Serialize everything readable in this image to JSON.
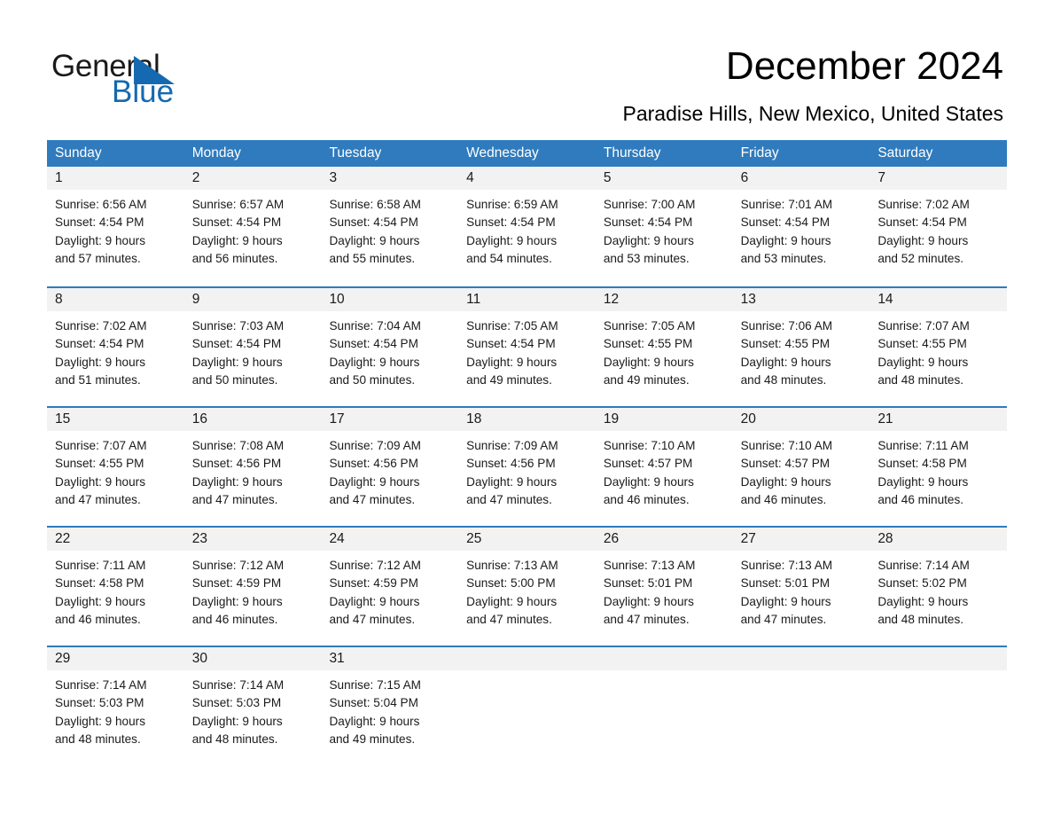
{
  "brand": {
    "name_part1": "General",
    "name_part2": "Blue",
    "accent_color": "#1569b0",
    "triangle_color": "#1569b0"
  },
  "header": {
    "title": "December 2024",
    "location": "Paradise Hills, New Mexico, United States"
  },
  "calendar": {
    "header_bg": "#2f7bbd",
    "day_band_bg": "#f2f2f2",
    "weekday_labels": [
      "Sunday",
      "Monday",
      "Tuesday",
      "Wednesday",
      "Thursday",
      "Friday",
      "Saturday"
    ],
    "weeks": [
      [
        {
          "day": "1",
          "sunrise": "Sunrise: 6:56 AM",
          "sunset": "Sunset: 4:54 PM",
          "daylight_line1": "Daylight: 9 hours",
          "daylight_line2": "and 57 minutes."
        },
        {
          "day": "2",
          "sunrise": "Sunrise: 6:57 AM",
          "sunset": "Sunset: 4:54 PM",
          "daylight_line1": "Daylight: 9 hours",
          "daylight_line2": "and 56 minutes."
        },
        {
          "day": "3",
          "sunrise": "Sunrise: 6:58 AM",
          "sunset": "Sunset: 4:54 PM",
          "daylight_line1": "Daylight: 9 hours",
          "daylight_line2": "and 55 minutes."
        },
        {
          "day": "4",
          "sunrise": "Sunrise: 6:59 AM",
          "sunset": "Sunset: 4:54 PM",
          "daylight_line1": "Daylight: 9 hours",
          "daylight_line2": "and 54 minutes."
        },
        {
          "day": "5",
          "sunrise": "Sunrise: 7:00 AM",
          "sunset": "Sunset: 4:54 PM",
          "daylight_line1": "Daylight: 9 hours",
          "daylight_line2": "and 53 minutes."
        },
        {
          "day": "6",
          "sunrise": "Sunrise: 7:01 AM",
          "sunset": "Sunset: 4:54 PM",
          "daylight_line1": "Daylight: 9 hours",
          "daylight_line2": "and 53 minutes."
        },
        {
          "day": "7",
          "sunrise": "Sunrise: 7:02 AM",
          "sunset": "Sunset: 4:54 PM",
          "daylight_line1": "Daylight: 9 hours",
          "daylight_line2": "and 52 minutes."
        }
      ],
      [
        {
          "day": "8",
          "sunrise": "Sunrise: 7:02 AM",
          "sunset": "Sunset: 4:54 PM",
          "daylight_line1": "Daylight: 9 hours",
          "daylight_line2": "and 51 minutes."
        },
        {
          "day": "9",
          "sunrise": "Sunrise: 7:03 AM",
          "sunset": "Sunset: 4:54 PM",
          "daylight_line1": "Daylight: 9 hours",
          "daylight_line2": "and 50 minutes."
        },
        {
          "day": "10",
          "sunrise": "Sunrise: 7:04 AM",
          "sunset": "Sunset: 4:54 PM",
          "daylight_line1": "Daylight: 9 hours",
          "daylight_line2": "and 50 minutes."
        },
        {
          "day": "11",
          "sunrise": "Sunrise: 7:05 AM",
          "sunset": "Sunset: 4:54 PM",
          "daylight_line1": "Daylight: 9 hours",
          "daylight_line2": "and 49 minutes."
        },
        {
          "day": "12",
          "sunrise": "Sunrise: 7:05 AM",
          "sunset": "Sunset: 4:55 PM",
          "daylight_line1": "Daylight: 9 hours",
          "daylight_line2": "and 49 minutes."
        },
        {
          "day": "13",
          "sunrise": "Sunrise: 7:06 AM",
          "sunset": "Sunset: 4:55 PM",
          "daylight_line1": "Daylight: 9 hours",
          "daylight_line2": "and 48 minutes."
        },
        {
          "day": "14",
          "sunrise": "Sunrise: 7:07 AM",
          "sunset": "Sunset: 4:55 PM",
          "daylight_line1": "Daylight: 9 hours",
          "daylight_line2": "and 48 minutes."
        }
      ],
      [
        {
          "day": "15",
          "sunrise": "Sunrise: 7:07 AM",
          "sunset": "Sunset: 4:55 PM",
          "daylight_line1": "Daylight: 9 hours",
          "daylight_line2": "and 47 minutes."
        },
        {
          "day": "16",
          "sunrise": "Sunrise: 7:08 AM",
          "sunset": "Sunset: 4:56 PM",
          "daylight_line1": "Daylight: 9 hours",
          "daylight_line2": "and 47 minutes."
        },
        {
          "day": "17",
          "sunrise": "Sunrise: 7:09 AM",
          "sunset": "Sunset: 4:56 PM",
          "daylight_line1": "Daylight: 9 hours",
          "daylight_line2": "and 47 minutes."
        },
        {
          "day": "18",
          "sunrise": "Sunrise: 7:09 AM",
          "sunset": "Sunset: 4:56 PM",
          "daylight_line1": "Daylight: 9 hours",
          "daylight_line2": "and 47 minutes."
        },
        {
          "day": "19",
          "sunrise": "Sunrise: 7:10 AM",
          "sunset": "Sunset: 4:57 PM",
          "daylight_line1": "Daylight: 9 hours",
          "daylight_line2": "and 46 minutes."
        },
        {
          "day": "20",
          "sunrise": "Sunrise: 7:10 AM",
          "sunset": "Sunset: 4:57 PM",
          "daylight_line1": "Daylight: 9 hours",
          "daylight_line2": "and 46 minutes."
        },
        {
          "day": "21",
          "sunrise": "Sunrise: 7:11 AM",
          "sunset": "Sunset: 4:58 PM",
          "daylight_line1": "Daylight: 9 hours",
          "daylight_line2": "and 46 minutes."
        }
      ],
      [
        {
          "day": "22",
          "sunrise": "Sunrise: 7:11 AM",
          "sunset": "Sunset: 4:58 PM",
          "daylight_line1": "Daylight: 9 hours",
          "daylight_line2": "and 46 minutes."
        },
        {
          "day": "23",
          "sunrise": "Sunrise: 7:12 AM",
          "sunset": "Sunset: 4:59 PM",
          "daylight_line1": "Daylight: 9 hours",
          "daylight_line2": "and 46 minutes."
        },
        {
          "day": "24",
          "sunrise": "Sunrise: 7:12 AM",
          "sunset": "Sunset: 4:59 PM",
          "daylight_line1": "Daylight: 9 hours",
          "daylight_line2": "and 47 minutes."
        },
        {
          "day": "25",
          "sunrise": "Sunrise: 7:13 AM",
          "sunset": "Sunset: 5:00 PM",
          "daylight_line1": "Daylight: 9 hours",
          "daylight_line2": "and 47 minutes."
        },
        {
          "day": "26",
          "sunrise": "Sunrise: 7:13 AM",
          "sunset": "Sunset: 5:01 PM",
          "daylight_line1": "Daylight: 9 hours",
          "daylight_line2": "and 47 minutes."
        },
        {
          "day": "27",
          "sunrise": "Sunrise: 7:13 AM",
          "sunset": "Sunset: 5:01 PM",
          "daylight_line1": "Daylight: 9 hours",
          "daylight_line2": "and 47 minutes."
        },
        {
          "day": "28",
          "sunrise": "Sunrise: 7:14 AM",
          "sunset": "Sunset: 5:02 PM",
          "daylight_line1": "Daylight: 9 hours",
          "daylight_line2": "and 48 minutes."
        }
      ],
      [
        {
          "day": "29",
          "sunrise": "Sunrise: 7:14 AM",
          "sunset": "Sunset: 5:03 PM",
          "daylight_line1": "Daylight: 9 hours",
          "daylight_line2": "and 48 minutes."
        },
        {
          "day": "30",
          "sunrise": "Sunrise: 7:14 AM",
          "sunset": "Sunset: 5:03 PM",
          "daylight_line1": "Daylight: 9 hours",
          "daylight_line2": "and 48 minutes."
        },
        {
          "day": "31",
          "sunrise": "Sunrise: 7:15 AM",
          "sunset": "Sunset: 5:04 PM",
          "daylight_line1": "Daylight: 9 hours",
          "daylight_line2": "and 49 minutes."
        },
        {
          "day": "",
          "sunrise": "",
          "sunset": "",
          "daylight_line1": "",
          "daylight_line2": ""
        },
        {
          "day": "",
          "sunrise": "",
          "sunset": "",
          "daylight_line1": "",
          "daylight_line2": ""
        },
        {
          "day": "",
          "sunrise": "",
          "sunset": "",
          "daylight_line1": "",
          "daylight_line2": ""
        },
        {
          "day": "",
          "sunrise": "",
          "sunset": "",
          "daylight_line1": "",
          "daylight_line2": ""
        }
      ]
    ]
  }
}
